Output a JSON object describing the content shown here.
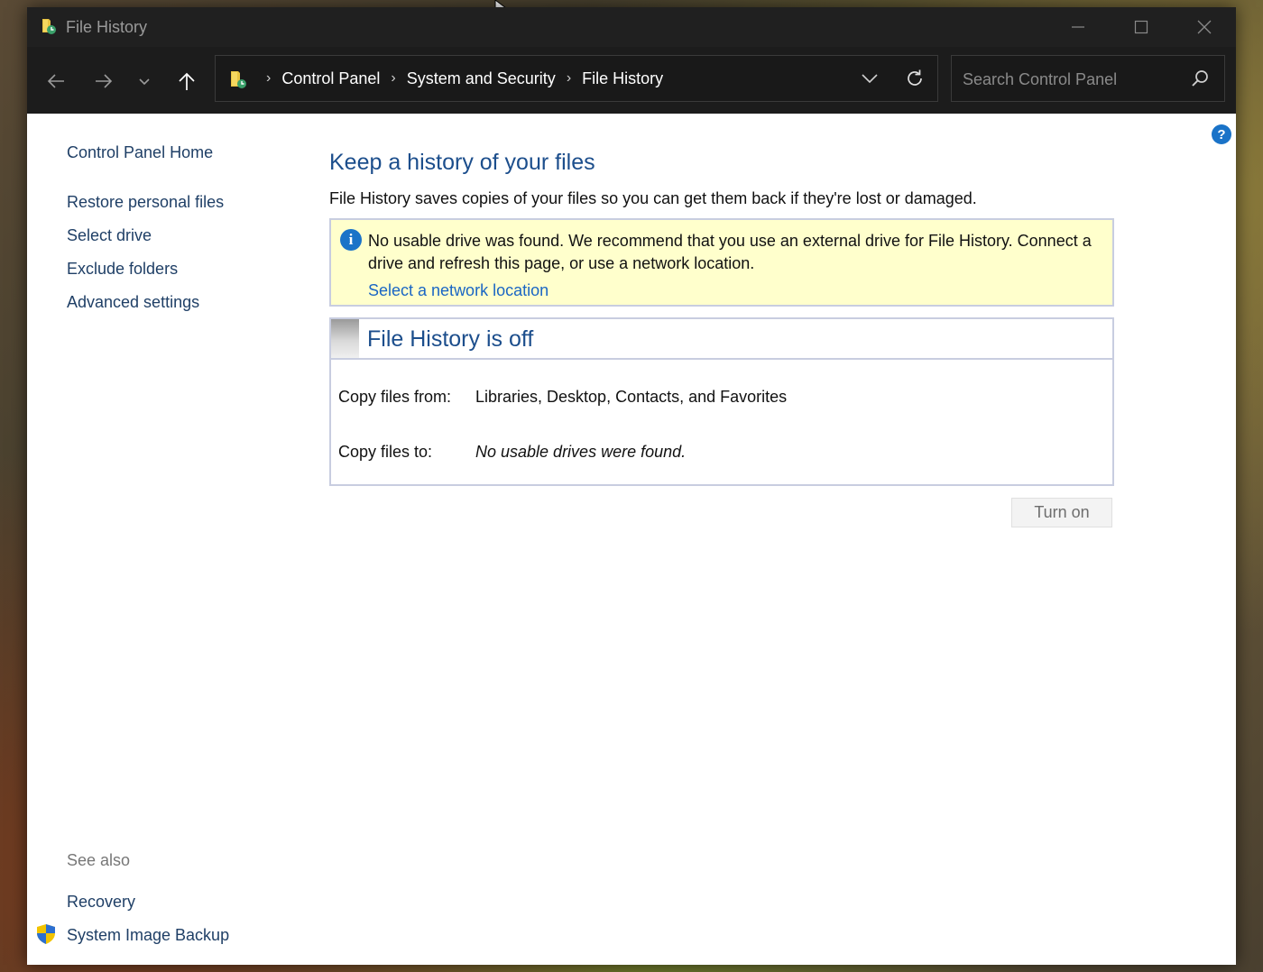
{
  "window": {
    "title": "File History"
  },
  "address_bar": {
    "breadcrumbs": [
      "Control Panel",
      "System and Security",
      "File History"
    ]
  },
  "search": {
    "placeholder": "Search Control Panel"
  },
  "sidebar": {
    "home": "Control Panel Home",
    "links": [
      "Restore personal files",
      "Select drive",
      "Exclude folders",
      "Advanced settings"
    ],
    "see_also_heading": "See also",
    "see_also_links": [
      "Recovery",
      "System Image Backup"
    ]
  },
  "main": {
    "title": "Keep a history of your files",
    "description": "File History saves copies of your files so you can get them back if they're lost or damaged.",
    "notice": {
      "text": "No usable drive was found. We recommend that you use an external drive for File History. Connect a drive and refresh this page, or use a network location.",
      "link": "Select a network location"
    },
    "status": {
      "title": "File History is off",
      "copy_from_label": "Copy files from:",
      "copy_from_value": "Libraries, Desktop, Contacts, and Favorites",
      "copy_to_label": "Copy files to:",
      "copy_to_value": "No usable drives were found."
    },
    "turn_on_button": "Turn on"
  },
  "colors": {
    "link": "#1f3f66",
    "heading": "#1c4e8c",
    "notice_background": "#ffffcc",
    "accent": "#1a73c8"
  }
}
